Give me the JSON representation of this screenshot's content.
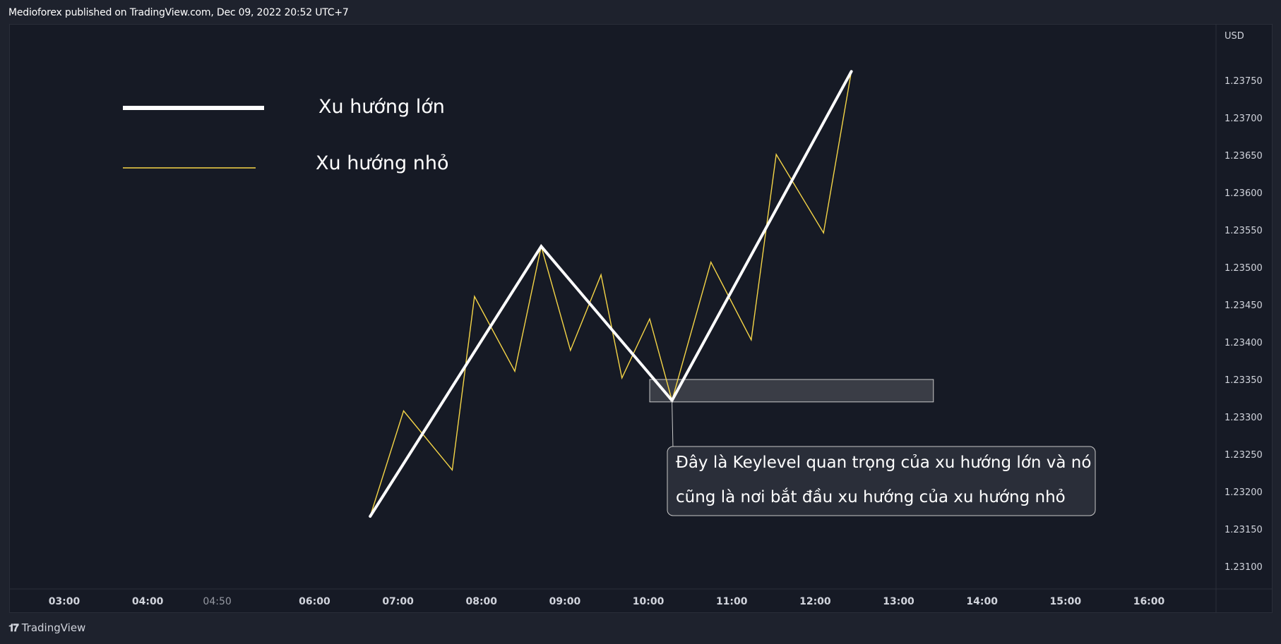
{
  "header": {
    "published": "Medioforex published on TradingView.com, Dec 09, 2022 20:52 UTC+7"
  },
  "footer": {
    "brand": "TradingView",
    "logo_icon": "tradingview-logo-icon"
  },
  "legend": [
    {
      "label": "Xu hướng lớn",
      "color": "#ffffff",
      "style": "thick"
    },
    {
      "label": "Xu hướng nhỏ",
      "color": "#f5d547",
      "style": "thin"
    }
  ],
  "annotation": {
    "lines": [
      "Đây là Keylevel quan trọng của xu hướng lớn và nó",
      "cũng là nơi bắt đầu xu hướng của xu hướng nhỏ"
    ]
  },
  "chart_data": {
    "type": "line",
    "currency_label": "USD",
    "y_ticks": [
      "1.23750",
      "1.23700",
      "1.23650",
      "1.23600",
      "1.23550",
      "1.23500",
      "1.23450",
      "1.23400",
      "1.23350",
      "1.23300",
      "1.23250",
      "1.23200",
      "1.23150",
      "1.23100"
    ],
    "x_ticks": [
      "03:00",
      "04:00",
      "04:50",
      "06:00",
      "07:00",
      "08:00",
      "09:00",
      "10:00",
      "11:00",
      "12:00",
      "13:00",
      "14:00",
      "15:00",
      "16:00"
    ],
    "ylim": [
      1.23065,
      1.23795
    ],
    "series": [
      {
        "color": "#ffffff",
        "points": [
          {
            "x": "06:40",
            "y": 1.23167
          },
          {
            "x": "08:43",
            "y": 1.23528
          },
          {
            "x": "10:17",
            "y": 1.23322
          },
          {
            "x": "12:26",
            "y": 1.23762
          }
        ]
      },
      {
        "color": "#f5d547",
        "points": [
          {
            "x": "06:40",
            "y": 1.23167
          },
          {
            "x": "07:04",
            "y": 1.23308
          },
          {
            "x": "07:39",
            "y": 1.23229
          },
          {
            "x": "07:55",
            "y": 1.23461
          },
          {
            "x": "08:24",
            "y": 1.23361
          },
          {
            "x": "08:43",
            "y": 1.23528
          },
          {
            "x": "09:04",
            "y": 1.23389
          },
          {
            "x": "09:26",
            "y": 1.2349
          },
          {
            "x": "09:41",
            "y": 1.23352
          },
          {
            "x": "10:01",
            "y": 1.23431
          },
          {
            "x": "10:17",
            "y": 1.23322
          },
          {
            "x": "10:45",
            "y": 1.23507
          },
          {
            "x": "11:14",
            "y": 1.23403
          },
          {
            "x": "11:32",
            "y": 1.23651
          },
          {
            "x": "12:06",
            "y": 1.23546
          },
          {
            "x": "12:26",
            "y": 1.23762
          }
        ]
      }
    ],
    "keylevel_zone": {
      "x_start": "10:01",
      "x_end": "13:25",
      "y_low": 1.2332,
      "y_high": 1.2335
    }
  }
}
